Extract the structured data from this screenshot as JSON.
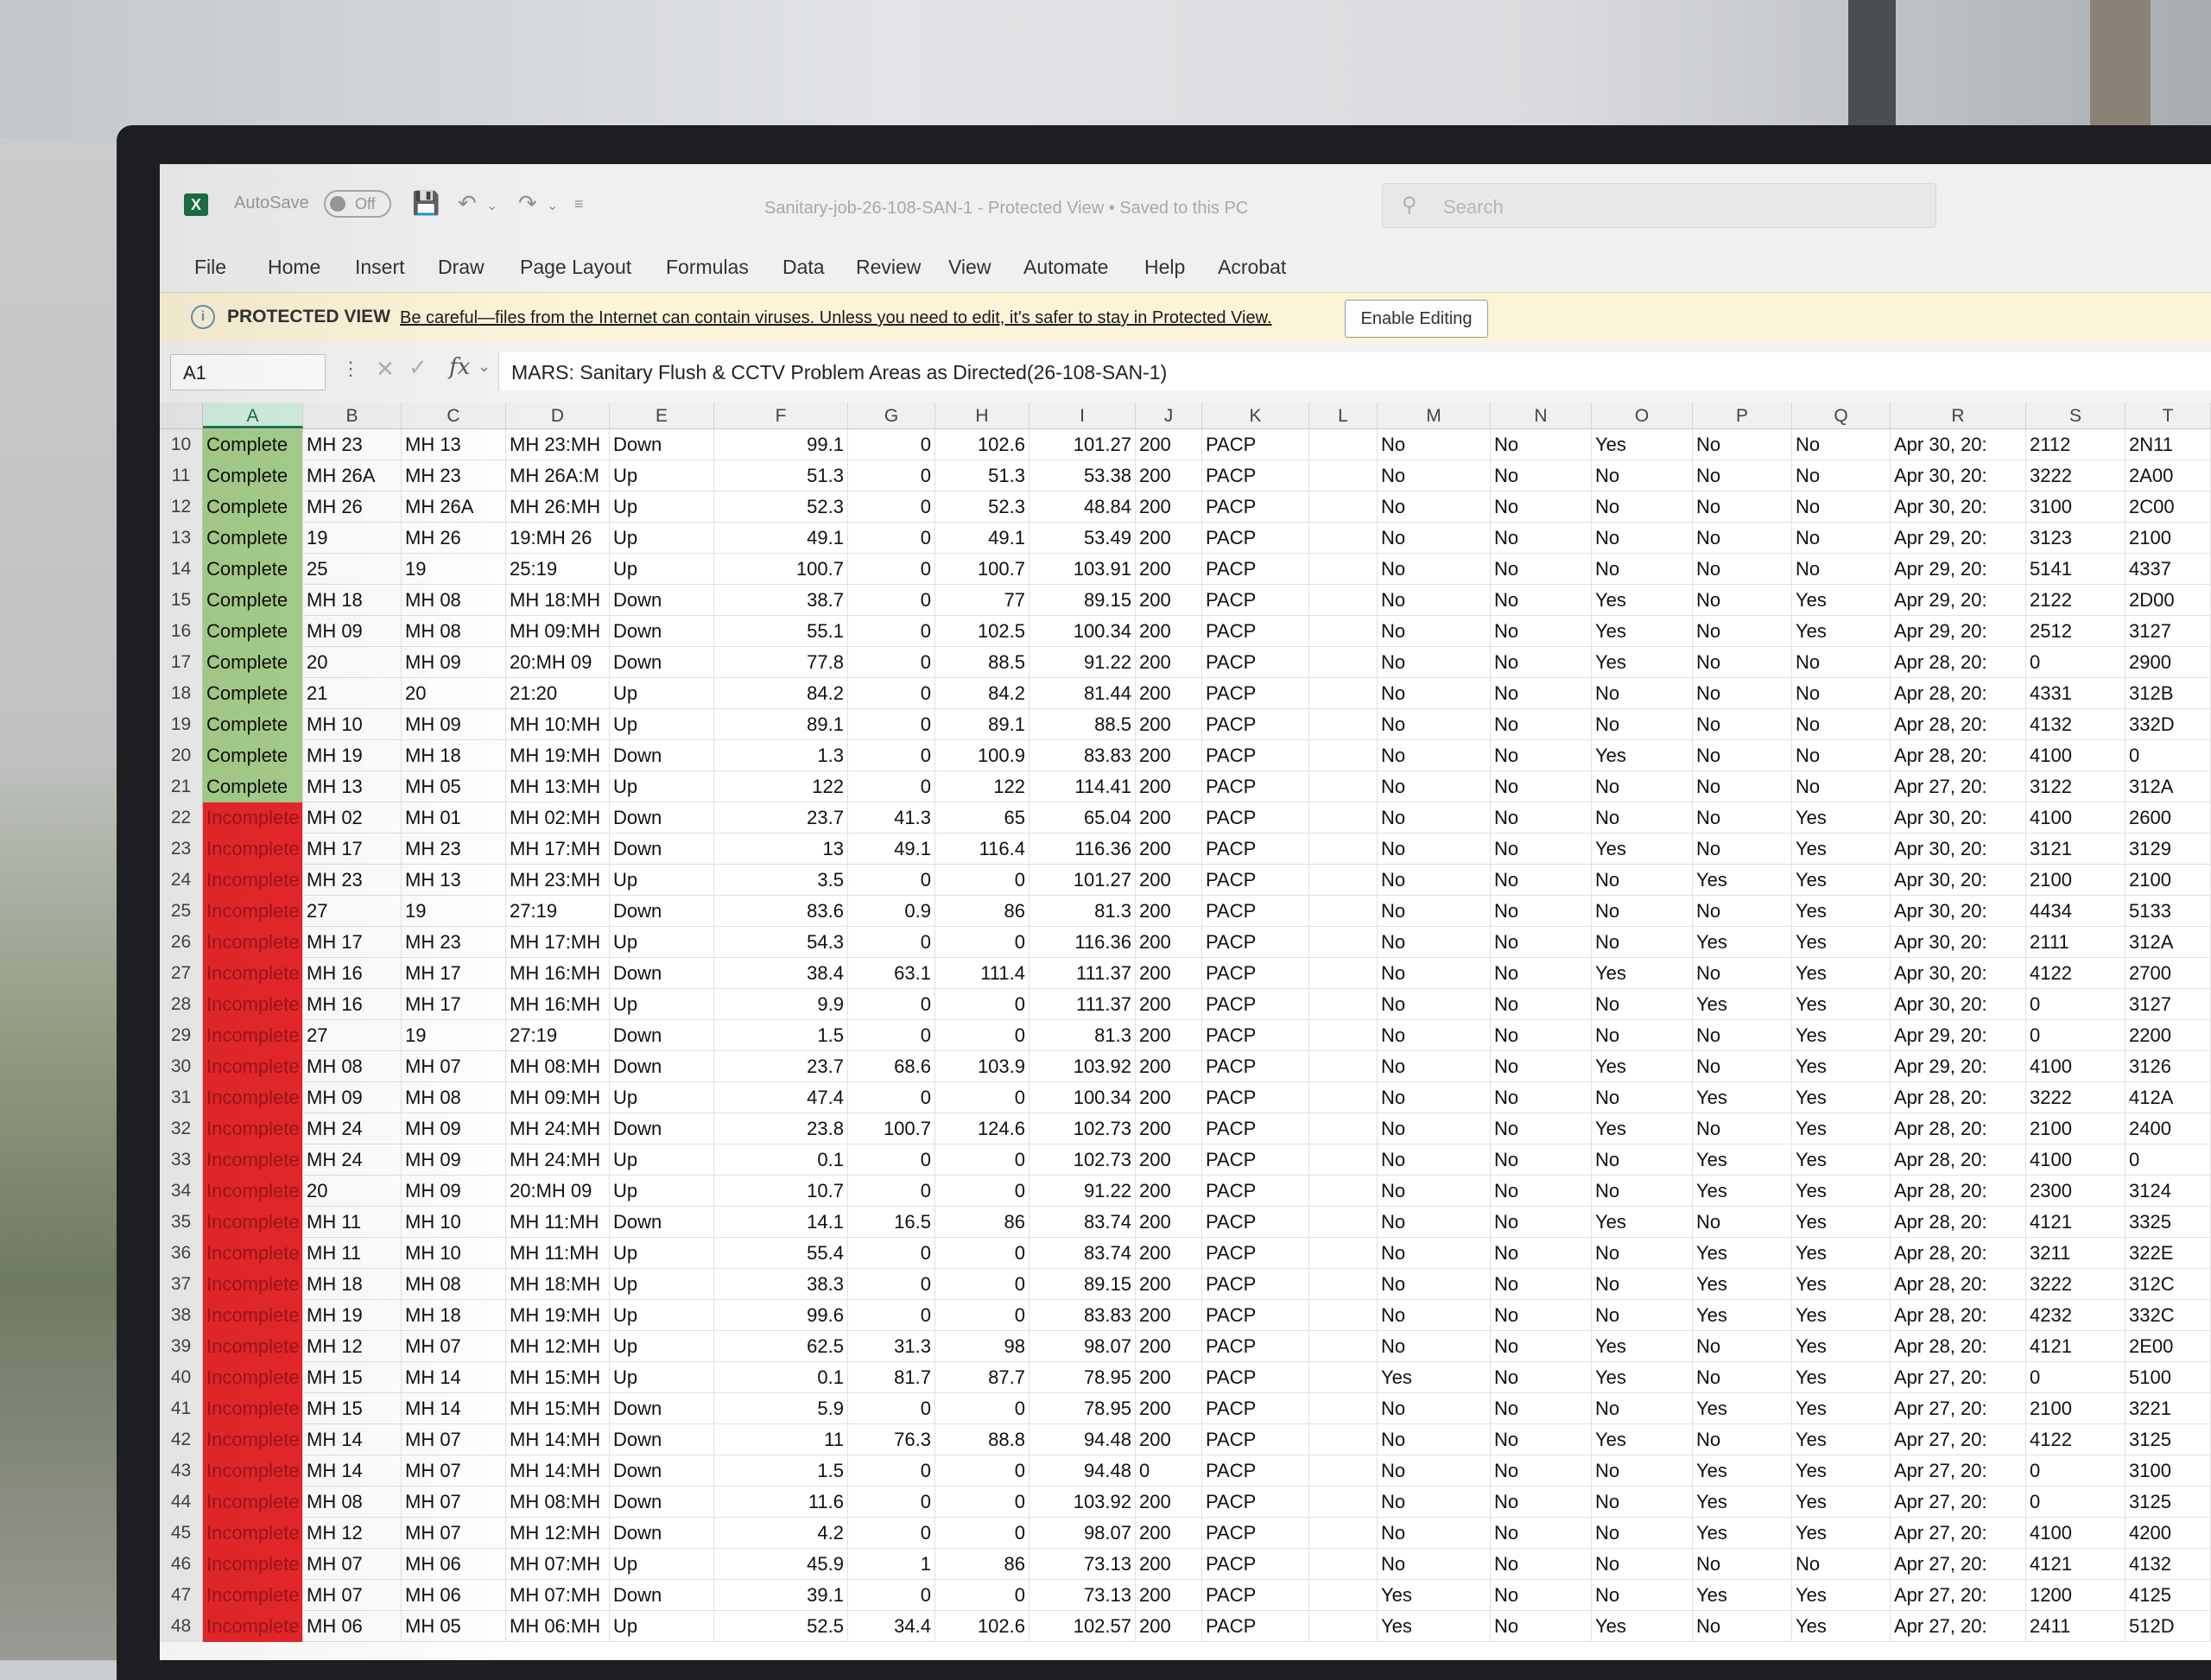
{
  "app": {
    "autosave_label": "AutoSave",
    "autosave_state": "Off",
    "doc_title": "Sanitary-job-26-108-SAN-1  -  Protected View  •  Saved to this PC",
    "search_placeholder": "Search",
    "accent": "#1d6f42"
  },
  "menu": [
    "File",
    "Home",
    "Insert",
    "Draw",
    "Page Layout",
    "Formulas",
    "Data",
    "Review",
    "View",
    "Automate",
    "Help",
    "Acrobat"
  ],
  "protected_view": {
    "title": "PROTECTED VIEW",
    "message": "Be careful—files from the Internet can contain viruses. Unless you need to edit, it's safer to stay in Protected View.",
    "button": "Enable Editing"
  },
  "formula_bar": {
    "name_box": "A1",
    "fx": "fx",
    "value": "MARS: Sanitary Flush & CCTV Problem Areas as Directed(26-108-SAN-1)"
  },
  "columns": [
    "A",
    "B",
    "C",
    "D",
    "E",
    "F",
    "G",
    "H",
    "I",
    "J",
    "K",
    "L",
    "M",
    "N",
    "O",
    "P",
    "Q",
    "R",
    "S",
    "T"
  ],
  "status_colors": {
    "Complete": "#a7d08c",
    "Incomplete": "#e8272a"
  },
  "rows": [
    [
      "10",
      "Complete",
      "MH 23",
      "MH 13",
      "MH 23:MH",
      "Down",
      "99.1",
      "0",
      "102.6",
      "101.27",
      "200",
      "PACP",
      "",
      "No",
      "No",
      "Yes",
      "No",
      "No",
      "Apr 30, 20:",
      "2112",
      "2N11"
    ],
    [
      "11",
      "Complete",
      "MH 26A",
      "MH 23",
      "MH 26A:M",
      "Up",
      "51.3",
      "0",
      "51.3",
      "53.38",
      "200",
      "PACP",
      "",
      "No",
      "No",
      "No",
      "No",
      "No",
      "Apr 30, 20:",
      "3222",
      "2A00"
    ],
    [
      "12",
      "Complete",
      "MH 26",
      "MH 26A",
      "MH 26:MH",
      "Up",
      "52.3",
      "0",
      "52.3",
      "48.84",
      "200",
      "PACP",
      "",
      "No",
      "No",
      "No",
      "No",
      "No",
      "Apr 30, 20:",
      "3100",
      "2C00"
    ],
    [
      "13",
      "Complete",
      "19",
      "MH 26",
      "19:MH 26",
      "Up",
      "49.1",
      "0",
      "49.1",
      "53.49",
      "200",
      "PACP",
      "",
      "No",
      "No",
      "No",
      "No",
      "No",
      "Apr 29, 20:",
      "3123",
      "2100"
    ],
    [
      "14",
      "Complete",
      "25",
      "19",
      "25:19",
      "Up",
      "100.7",
      "0",
      "100.7",
      "103.91",
      "200",
      "PACP",
      "",
      "No",
      "No",
      "No",
      "No",
      "No",
      "Apr 29, 20:",
      "5141",
      "4337"
    ],
    [
      "15",
      "Complete",
      "MH 18",
      "MH 08",
      "MH 18:MH",
      "Down",
      "38.7",
      "0",
      "77",
      "89.15",
      "200",
      "PACP",
      "",
      "No",
      "No",
      "Yes",
      "No",
      "Yes",
      "Apr 29, 20:",
      "2122",
      "2D00"
    ],
    [
      "16",
      "Complete",
      "MH 09",
      "MH 08",
      "MH 09:MH",
      "Down",
      "55.1",
      "0",
      "102.5",
      "100.34",
      "200",
      "PACP",
      "",
      "No",
      "No",
      "Yes",
      "No",
      "Yes",
      "Apr 29, 20:",
      "2512",
      "3127"
    ],
    [
      "17",
      "Complete",
      "20",
      "MH 09",
      "20:MH 09",
      "Down",
      "77.8",
      "0",
      "88.5",
      "91.22",
      "200",
      "PACP",
      "",
      "No",
      "No",
      "Yes",
      "No",
      "No",
      "Apr 28, 20:",
      "0",
      "2900"
    ],
    [
      "18",
      "Complete",
      "21",
      "20",
      "21:20",
      "Up",
      "84.2",
      "0",
      "84.2",
      "81.44",
      "200",
      "PACP",
      "",
      "No",
      "No",
      "No",
      "No",
      "No",
      "Apr 28, 20:",
      "4331",
      "312B"
    ],
    [
      "19",
      "Complete",
      "MH 10",
      "MH 09",
      "MH 10:MH",
      "Up",
      "89.1",
      "0",
      "89.1",
      "88.5",
      "200",
      "PACP",
      "",
      "No",
      "No",
      "No",
      "No",
      "No",
      "Apr 28, 20:",
      "4132",
      "332D"
    ],
    [
      "20",
      "Complete",
      "MH 19",
      "MH 18",
      "MH 19:MH",
      "Down",
      "1.3",
      "0",
      "100.9",
      "83.83",
      "200",
      "PACP",
      "",
      "No",
      "No",
      "Yes",
      "No",
      "No",
      "Apr 28, 20:",
      "4100",
      "0"
    ],
    [
      "21",
      "Complete",
      "MH 13",
      "MH 05",
      "MH 13:MH",
      "Up",
      "122",
      "0",
      "122",
      "114.41",
      "200",
      "PACP",
      "",
      "No",
      "No",
      "No",
      "No",
      "No",
      "Apr 27, 20:",
      "3122",
      "312A"
    ],
    [
      "22",
      "Incomplete",
      "MH 02",
      "MH 01",
      "MH 02:MH",
      "Down",
      "23.7",
      "41.3",
      "65",
      "65.04",
      "200",
      "PACP",
      "",
      "No",
      "No",
      "No",
      "No",
      "Yes",
      "Apr 30, 20:",
      "4100",
      "2600"
    ],
    [
      "23",
      "Incomplete",
      "MH 17",
      "MH 23",
      "MH 17:MH",
      "Down",
      "13",
      "49.1",
      "116.4",
      "116.36",
      "200",
      "PACP",
      "",
      "No",
      "No",
      "Yes",
      "No",
      "Yes",
      "Apr 30, 20:",
      "3121",
      "3129"
    ],
    [
      "24",
      "Incomplete",
      "MH 23",
      "MH 13",
      "MH 23:MH",
      "Up",
      "3.5",
      "0",
      "0",
      "101.27",
      "200",
      "PACP",
      "",
      "No",
      "No",
      "No",
      "Yes",
      "Yes",
      "Apr 30, 20:",
      "2100",
      "2100"
    ],
    [
      "25",
      "Incomplete",
      "27",
      "19",
      "27:19",
      "Down",
      "83.6",
      "0.9",
      "86",
      "81.3",
      "200",
      "PACP",
      "",
      "No",
      "No",
      "No",
      "No",
      "Yes",
      "Apr 30, 20:",
      "4434",
      "5133"
    ],
    [
      "26",
      "Incomplete",
      "MH 17",
      "MH 23",
      "MH 17:MH",
      "Up",
      "54.3",
      "0",
      "0",
      "116.36",
      "200",
      "PACP",
      "",
      "No",
      "No",
      "No",
      "Yes",
      "Yes",
      "Apr 30, 20:",
      "2111",
      "312A"
    ],
    [
      "27",
      "Incomplete",
      "MH 16",
      "MH 17",
      "MH 16:MH",
      "Down",
      "38.4",
      "63.1",
      "111.4",
      "111.37",
      "200",
      "PACP",
      "",
      "No",
      "No",
      "Yes",
      "No",
      "Yes",
      "Apr 30, 20:",
      "4122",
      "2700"
    ],
    [
      "28",
      "Incomplete",
      "MH 16",
      "MH 17",
      "MH 16:MH",
      "Up",
      "9.9",
      "0",
      "0",
      "111.37",
      "200",
      "PACP",
      "",
      "No",
      "No",
      "No",
      "Yes",
      "Yes",
      "Apr 30, 20:",
      "0",
      "3127"
    ],
    [
      "29",
      "Incomplete",
      "27",
      "19",
      "27:19",
      "Down",
      "1.5",
      "0",
      "0",
      "81.3",
      "200",
      "PACP",
      "",
      "No",
      "No",
      "No",
      "No",
      "Yes",
      "Apr 29, 20:",
      "0",
      "2200"
    ],
    [
      "30",
      "Incomplete",
      "MH 08",
      "MH 07",
      "MH 08:MH",
      "Down",
      "23.7",
      "68.6",
      "103.9",
      "103.92",
      "200",
      "PACP",
      "",
      "No",
      "No",
      "Yes",
      "No",
      "Yes",
      "Apr 29, 20:",
      "4100",
      "3126"
    ],
    [
      "31",
      "Incomplete",
      "MH 09",
      "MH 08",
      "MH 09:MH",
      "Up",
      "47.4",
      "0",
      "0",
      "100.34",
      "200",
      "PACP",
      "",
      "No",
      "No",
      "No",
      "Yes",
      "Yes",
      "Apr 28, 20:",
      "3222",
      "412A"
    ],
    [
      "32",
      "Incomplete",
      "MH 24",
      "MH 09",
      "MH 24:MH",
      "Down",
      "23.8",
      "100.7",
      "124.6",
      "102.73",
      "200",
      "PACP",
      "",
      "No",
      "No",
      "Yes",
      "No",
      "Yes",
      "Apr 28, 20:",
      "2100",
      "2400"
    ],
    [
      "33",
      "Incomplete",
      "MH 24",
      "MH 09",
      "MH 24:MH",
      "Up",
      "0.1",
      "0",
      "0",
      "102.73",
      "200",
      "PACP",
      "",
      "No",
      "No",
      "No",
      "Yes",
      "Yes",
      "Apr 28, 20:",
      "4100",
      "0"
    ],
    [
      "34",
      "Incomplete",
      "20",
      "MH 09",
      "20:MH 09",
      "Up",
      "10.7",
      "0",
      "0",
      "91.22",
      "200",
      "PACP",
      "",
      "No",
      "No",
      "No",
      "Yes",
      "Yes",
      "Apr 28, 20:",
      "2300",
      "3124"
    ],
    [
      "35",
      "Incomplete",
      "MH 11",
      "MH 10",
      "MH 11:MH",
      "Down",
      "14.1",
      "16.5",
      "86",
      "83.74",
      "200",
      "PACP",
      "",
      "No",
      "No",
      "Yes",
      "No",
      "Yes",
      "Apr 28, 20:",
      "4121",
      "3325"
    ],
    [
      "36",
      "Incomplete",
      "MH 11",
      "MH 10",
      "MH 11:MH",
      "Up",
      "55.4",
      "0",
      "0",
      "83.74",
      "200",
      "PACP",
      "",
      "No",
      "No",
      "No",
      "Yes",
      "Yes",
      "Apr 28, 20:",
      "3211",
      "322E"
    ],
    [
      "37",
      "Incomplete",
      "MH 18",
      "MH 08",
      "MH 18:MH",
      "Up",
      "38.3",
      "0",
      "0",
      "89.15",
      "200",
      "PACP",
      "",
      "No",
      "No",
      "No",
      "Yes",
      "Yes",
      "Apr 28, 20:",
      "3222",
      "312C"
    ],
    [
      "38",
      "Incomplete",
      "MH 19",
      "MH 18",
      "MH 19:MH",
      "Up",
      "99.6",
      "0",
      "0",
      "83.83",
      "200",
      "PACP",
      "",
      "No",
      "No",
      "No",
      "Yes",
      "Yes",
      "Apr 28, 20:",
      "4232",
      "332C"
    ],
    [
      "39",
      "Incomplete",
      "MH 12",
      "MH 07",
      "MH 12:MH",
      "Up",
      "62.5",
      "31.3",
      "98",
      "98.07",
      "200",
      "PACP",
      "",
      "No",
      "No",
      "Yes",
      "No",
      "Yes",
      "Apr 28, 20:",
      "4121",
      "2E00"
    ],
    [
      "40",
      "Incomplete",
      "MH 15",
      "MH 14",
      "MH 15:MH",
      "Up",
      "0.1",
      "81.7",
      "87.7",
      "78.95",
      "200",
      "PACP",
      "",
      "Yes",
      "No",
      "Yes",
      "No",
      "Yes",
      "Apr 27, 20:",
      "0",
      "5100"
    ],
    [
      "41",
      "Incomplete",
      "MH 15",
      "MH 14",
      "MH 15:MH",
      "Down",
      "5.9",
      "0",
      "0",
      "78.95",
      "200",
      "PACP",
      "",
      "No",
      "No",
      "No",
      "Yes",
      "Yes",
      "Apr 27, 20:",
      "2100",
      "3221"
    ],
    [
      "42",
      "Incomplete",
      "MH 14",
      "MH 07",
      "MH 14:MH",
      "Down",
      "11",
      "76.3",
      "88.8",
      "94.48",
      "200",
      "PACP",
      "",
      "No",
      "No",
      "Yes",
      "No",
      "Yes",
      "Apr 27, 20:",
      "4122",
      "3125"
    ],
    [
      "43",
      "Incomplete",
      "MH 14",
      "MH 07",
      "MH 14:MH",
      "Down",
      "1.5",
      "0",
      "0",
      "94.48",
      "0",
      "PACP",
      "",
      "No",
      "No",
      "No",
      "Yes",
      "Yes",
      "Apr 27, 20:",
      "0",
      "3100"
    ],
    [
      "44",
      "Incomplete",
      "MH 08",
      "MH 07",
      "MH 08:MH",
      "Down",
      "11.6",
      "0",
      "0",
      "103.92",
      "200",
      "PACP",
      "",
      "No",
      "No",
      "No",
      "Yes",
      "Yes",
      "Apr 27, 20:",
      "0",
      "3125"
    ],
    [
      "45",
      "Incomplete",
      "MH 12",
      "MH 07",
      "MH 12:MH",
      "Down",
      "4.2",
      "0",
      "0",
      "98.07",
      "200",
      "PACP",
      "",
      "No",
      "No",
      "No",
      "Yes",
      "Yes",
      "Apr 27, 20:",
      "4100",
      "4200"
    ],
    [
      "46",
      "Incomplete",
      "MH 07",
      "MH 06",
      "MH 07:MH",
      "Up",
      "45.9",
      "1",
      "86",
      "73.13",
      "200",
      "PACP",
      "",
      "No",
      "No",
      "No",
      "No",
      "No",
      "Apr 27, 20:",
      "4121",
      "4132"
    ],
    [
      "47",
      "Incomplete",
      "MH 07",
      "MH 06",
      "MH 07:MH",
      "Down",
      "39.1",
      "0",
      "0",
      "73.13",
      "200",
      "PACP",
      "",
      "Yes",
      "No",
      "No",
      "Yes",
      "Yes",
      "Apr 27, 20:",
      "1200",
      "4125"
    ],
    [
      "48",
      "Incomplete",
      "MH 06",
      "MH 05",
      "MH 06:MH",
      "Up",
      "52.5",
      "34.4",
      "102.6",
      "102.57",
      "200",
      "PACP",
      "",
      "Yes",
      "No",
      "Yes",
      "No",
      "Yes",
      "Apr 27, 20:",
      "2411",
      "512D"
    ]
  ]
}
